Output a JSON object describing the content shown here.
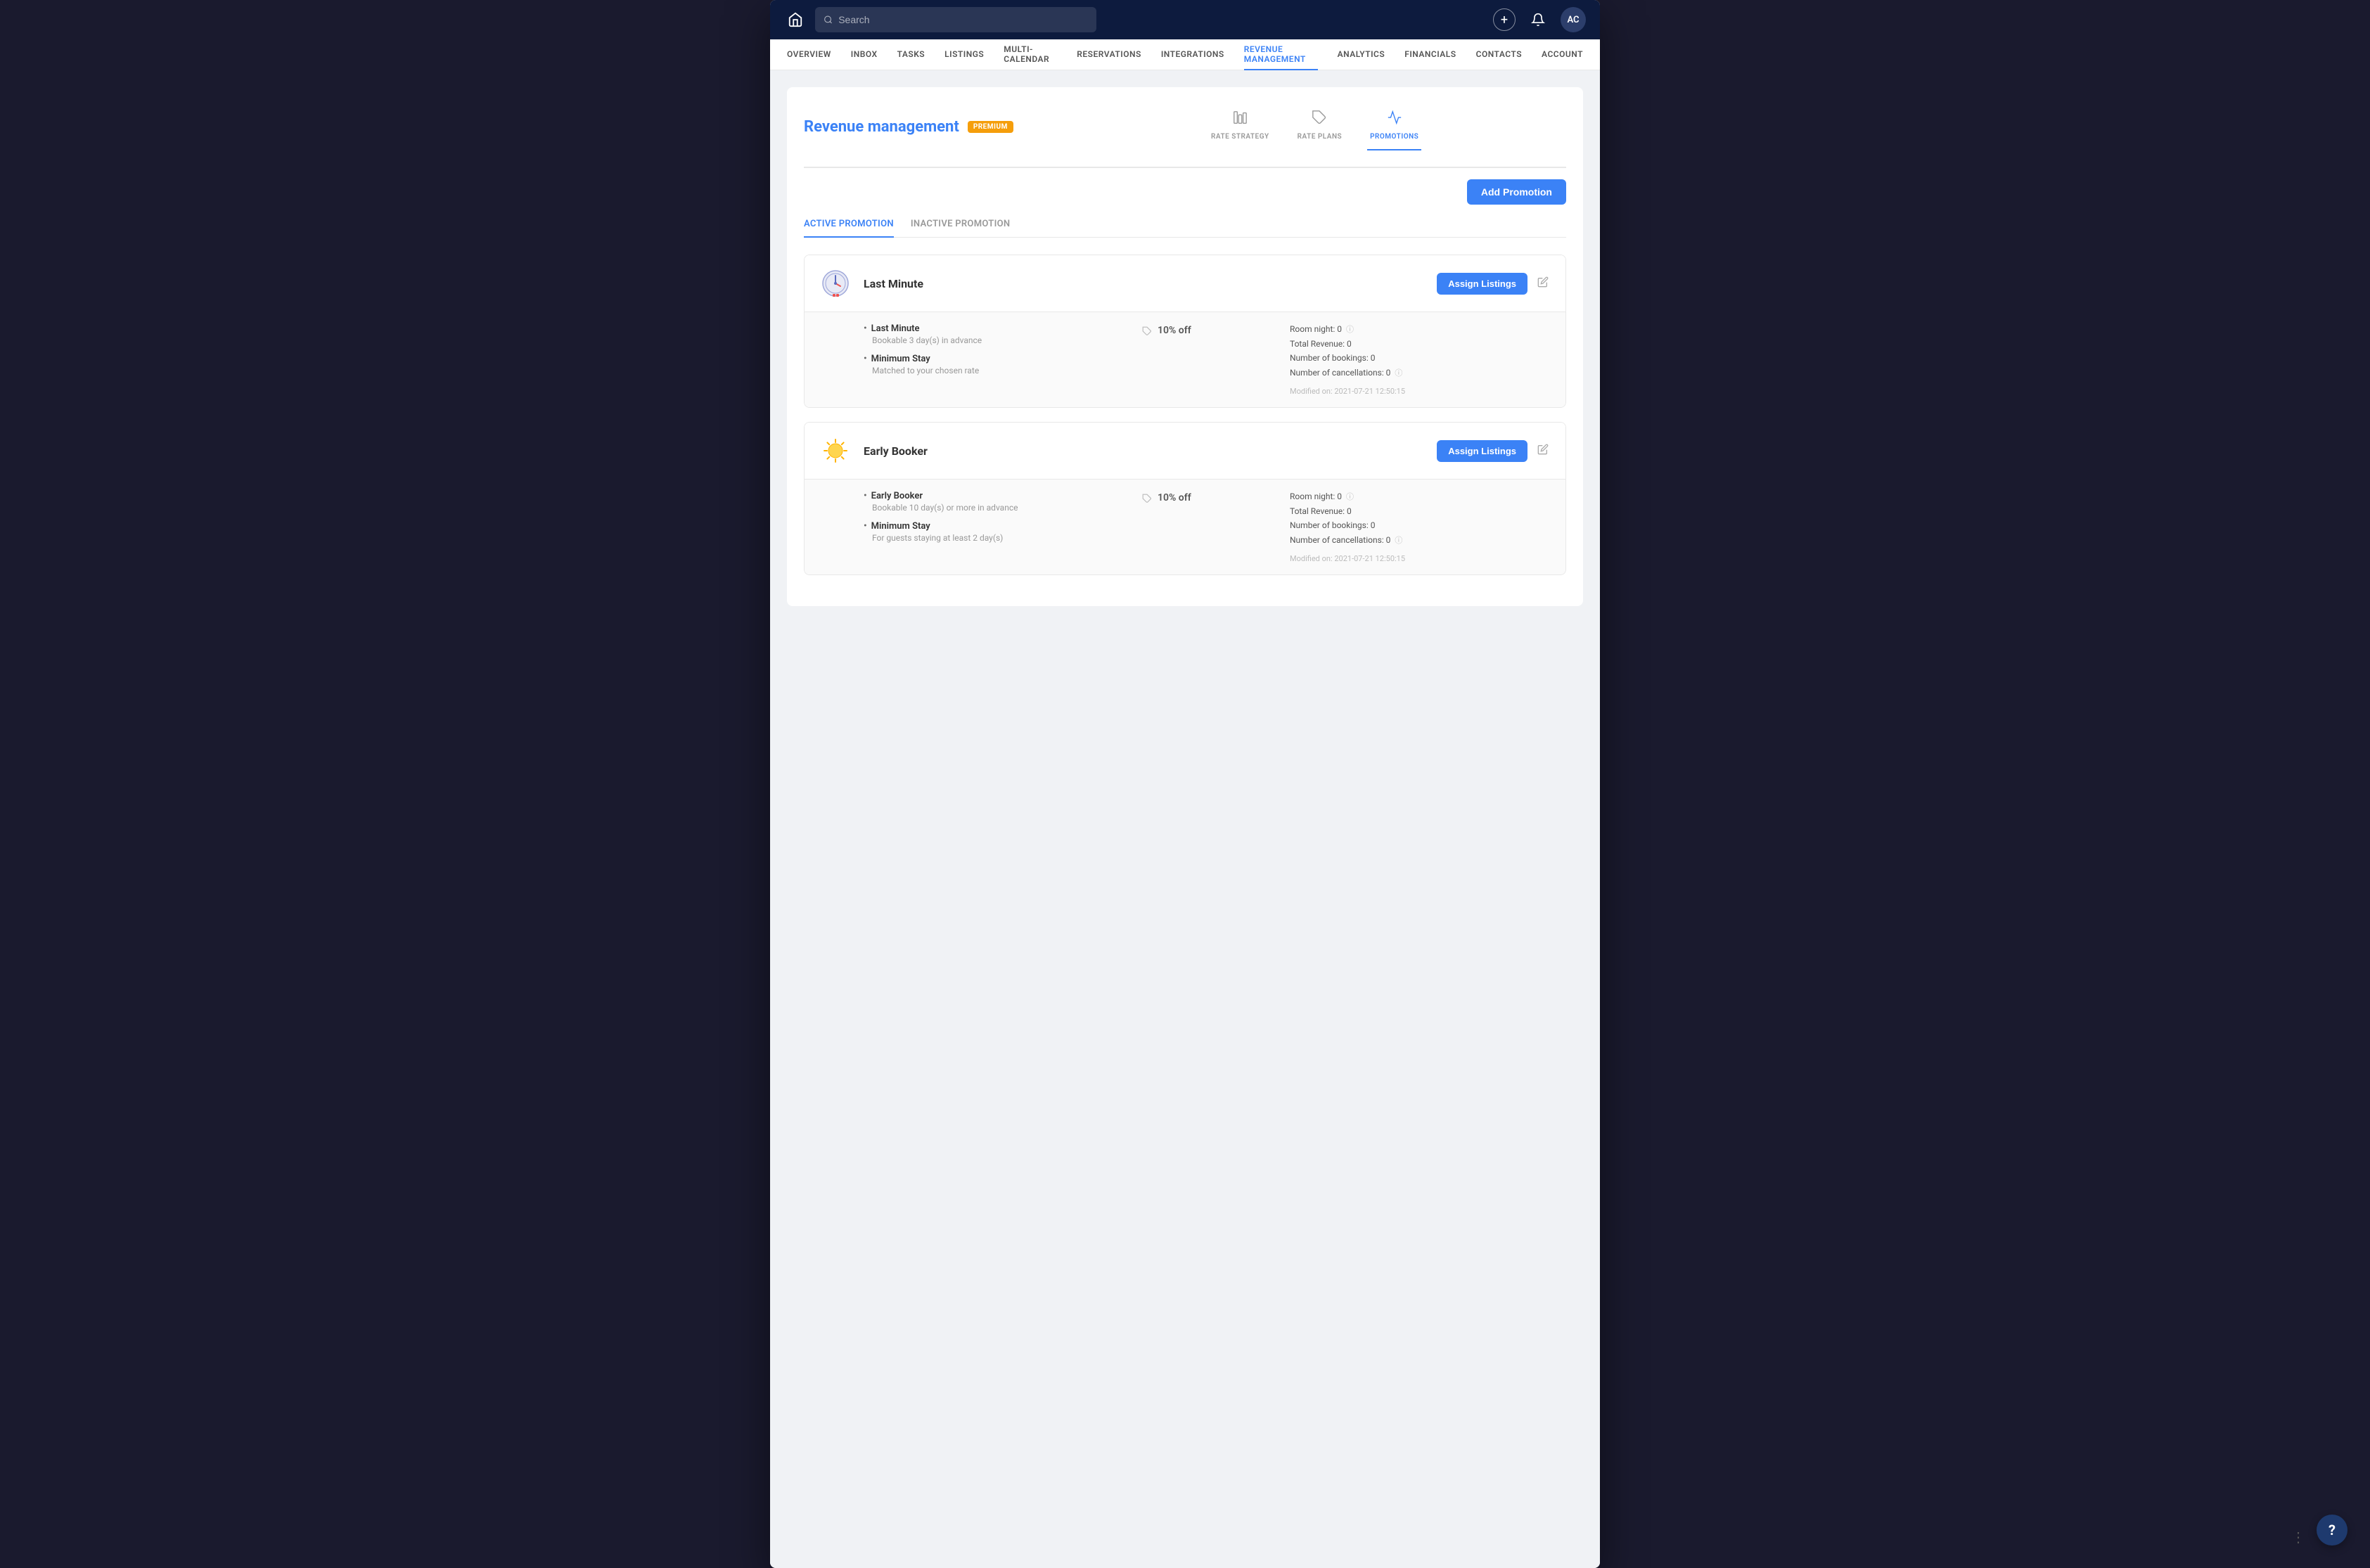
{
  "topbar": {
    "search_placeholder": "Search",
    "avatar_initials": "AC",
    "add_icon": "+",
    "bell_icon": "🔔"
  },
  "nav": {
    "items": [
      {
        "label": "OVERVIEW",
        "active": false
      },
      {
        "label": "INBOX",
        "active": false
      },
      {
        "label": "TASKS",
        "active": false
      },
      {
        "label": "LISTINGS",
        "active": false
      },
      {
        "label": "MULTI-CALENDAR",
        "active": false
      },
      {
        "label": "RESERVATIONS",
        "active": false
      },
      {
        "label": "INTEGRATIONS",
        "active": false
      },
      {
        "label": "REVENUE MANAGEMENT",
        "active": true
      },
      {
        "label": "ANALYTICS",
        "active": false
      },
      {
        "label": "FINANCIALS",
        "active": false
      },
      {
        "label": "CONTACTS",
        "active": false
      },
      {
        "label": "ACCOUNT",
        "active": false
      }
    ]
  },
  "page": {
    "title": "Revenue management",
    "badge": "PREMIUM"
  },
  "sub_nav": {
    "items": [
      {
        "label": "RATE STRATEGY",
        "icon": "⊞",
        "active": false
      },
      {
        "label": "RATE PLANS",
        "icon": "🏷",
        "active": false
      },
      {
        "label": "PROMOTIONS",
        "icon": "📢",
        "active": true
      }
    ]
  },
  "add_promotion_label": "Add Promotion",
  "promotion_tabs": [
    {
      "label": "ACTIVE PROMOTION",
      "active": true
    },
    {
      "label": "INACTIVE PROMOTION",
      "active": false
    }
  ],
  "promotions": [
    {
      "id": "last-minute",
      "name": "Last Minute",
      "icon": "⏱",
      "assign_label": "Assign Listings",
      "conditions": [
        {
          "title": "Last Minute",
          "sub": "Bookable 3 day(s) in advance"
        },
        {
          "title": "Minimum Stay",
          "sub": "Matched to your chosen rate"
        }
      ],
      "discount": "10% off",
      "stats": {
        "room_night": "Room night: 0",
        "total_revenue": "Total Revenue: 0",
        "number_of_bookings": "Number of bookings: 0",
        "number_of_cancellations": "Number of cancellations: 0",
        "modified": "Modified on: 2021-07-21 12:50:15"
      }
    },
    {
      "id": "early-booker",
      "name": "Early Booker",
      "icon": "☀",
      "assign_label": "Assign Listings",
      "conditions": [
        {
          "title": "Early Booker",
          "sub": "Bookable 10 day(s) or more in advance"
        },
        {
          "title": "Minimum Stay",
          "sub": "For guests staying at least 2 day(s)"
        }
      ],
      "discount": "10% off",
      "stats": {
        "room_night": "Room night: 0",
        "total_revenue": "Total Revenue: 0",
        "number_of_bookings": "Number of bookings: 0",
        "number_of_cancellations": "Number of cancellations: 0",
        "modified": "Modified on: 2021-07-21 12:50:15"
      }
    }
  ],
  "help_label": "?"
}
